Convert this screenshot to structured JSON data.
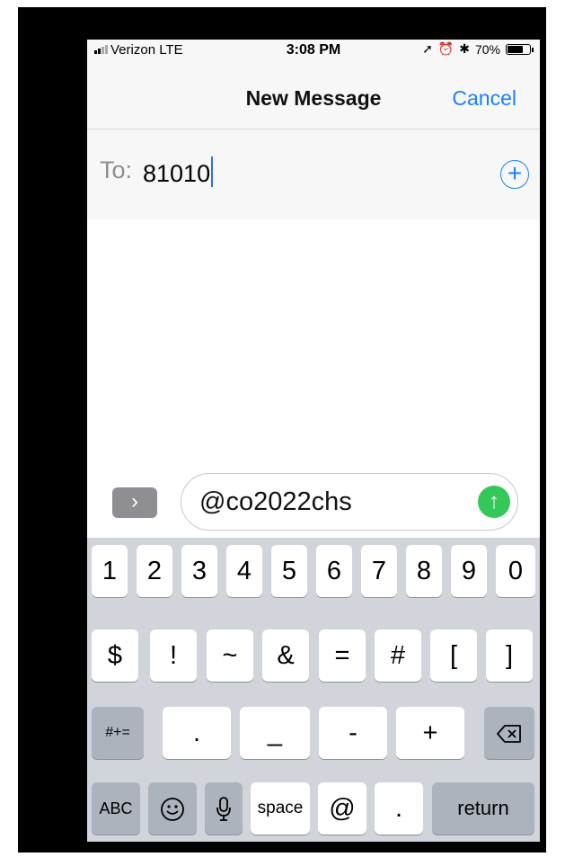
{
  "status_bar": {
    "carrier": "Verizon  LTE",
    "time": "3:08 PM",
    "battery": "70%",
    "battery_level": 0.7
  },
  "nav": {
    "title": "New Message",
    "cancel": "Cancel"
  },
  "recipient": {
    "label": "To:",
    "value": "81010"
  },
  "compose": {
    "text": "@co2022chs"
  },
  "keyboard": {
    "row1": [
      "1",
      "2",
      "3",
      "4",
      "5",
      "6",
      "7",
      "8",
      "9",
      "0"
    ],
    "row2": [
      "$",
      "!",
      "~",
      "&",
      "=",
      "#",
      "[",
      "]"
    ],
    "row3": [
      ".",
      "_",
      "-",
      "+"
    ],
    "symbols_toggle": "#+=",
    "abc": "ABC",
    "space": "space",
    "at": "@",
    "dot": ".",
    "return": "return"
  },
  "colors": {
    "accent": "#1a82fb",
    "send": "#34c759",
    "keyboard_bg": "#d1d4db"
  }
}
